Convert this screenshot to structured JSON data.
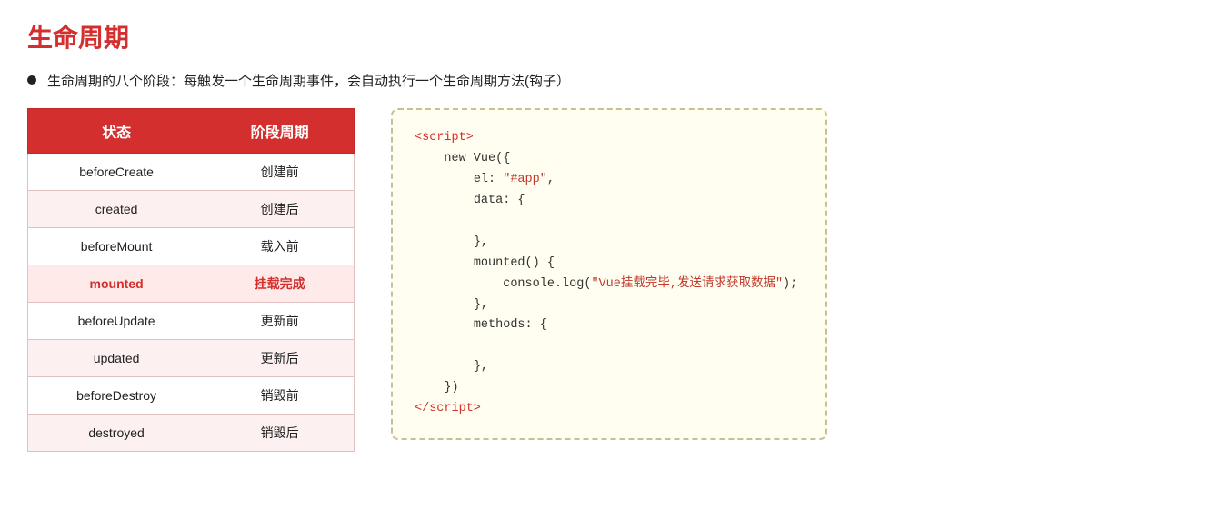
{
  "title": "生命周期",
  "bullet": "生命周期的八个阶段：每触发一个生命周期事件，会自动执行一个生命周期方法(钩子）",
  "table": {
    "headers": [
      "状态",
      "阶段周期"
    ],
    "rows": [
      {
        "state": "beforeCreate",
        "phase": "创建前",
        "highlight": false
      },
      {
        "state": "created",
        "phase": "创建后",
        "highlight": false
      },
      {
        "state": "beforeMount",
        "phase": "载入前",
        "highlight": false
      },
      {
        "state": "mounted",
        "phase": "挂载完成",
        "highlight": true
      },
      {
        "state": "beforeUpdate",
        "phase": "更新前",
        "highlight": false
      },
      {
        "state": "updated",
        "phase": "更新后",
        "highlight": false
      },
      {
        "state": "beforeDestroy",
        "phase": "销毁前",
        "highlight": false
      },
      {
        "state": "destroyed",
        "phase": "销毁后",
        "highlight": false
      }
    ]
  },
  "code": {
    "lines": [
      {
        "indent": 0,
        "parts": [
          {
            "type": "tag",
            "text": "<script>"
          }
        ]
      },
      {
        "indent": 1,
        "parts": [
          {
            "type": "key",
            "text": "new Vue({"
          }
        ]
      },
      {
        "indent": 2,
        "parts": [
          {
            "type": "key",
            "text": "el: "
          },
          {
            "type": "string",
            "text": "\"#app\""
          },
          {
            "type": "key",
            "text": ","
          }
        ]
      },
      {
        "indent": 2,
        "parts": [
          {
            "type": "key",
            "text": "data: {"
          }
        ]
      },
      {
        "indent": 3,
        "parts": [
          {
            "type": "key",
            "text": ""
          }
        ]
      },
      {
        "indent": 2,
        "parts": [
          {
            "type": "key",
            "text": "},"
          }
        ]
      },
      {
        "indent": 2,
        "parts": [
          {
            "type": "key",
            "text": "mounted() {"
          }
        ]
      },
      {
        "indent": 3,
        "parts": [
          {
            "type": "key",
            "text": "console.log("
          },
          {
            "type": "string",
            "text": "\"Vue挂载完毕,发送请求获取数据\""
          },
          {
            "type": "key",
            "text": ");"
          }
        ]
      },
      {
        "indent": 2,
        "parts": [
          {
            "type": "key",
            "text": "},"
          }
        ]
      },
      {
        "indent": 2,
        "parts": [
          {
            "type": "key",
            "text": "methods: {"
          }
        ]
      },
      {
        "indent": 3,
        "parts": [
          {
            "type": "key",
            "text": ""
          }
        ]
      },
      {
        "indent": 2,
        "parts": [
          {
            "type": "key",
            "text": "},"
          }
        ]
      },
      {
        "indent": 1,
        "parts": [
          {
            "type": "key",
            "text": "})"
          }
        ]
      },
      {
        "indent": 0,
        "parts": [
          {
            "type": "tag",
            "text": "</script>"
          }
        ]
      }
    ]
  }
}
